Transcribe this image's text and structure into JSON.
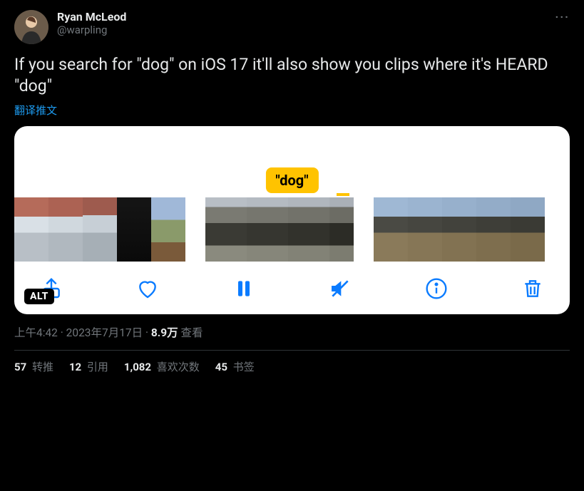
{
  "user": {
    "display_name": "Ryan McLeod",
    "handle": "@warpling"
  },
  "tweet": {
    "text": "If you search for \"dog\" on iOS 17 it'll also show you clips where it's HEARD \"dog\"",
    "translate_label": "翻译推文"
  },
  "media": {
    "search_label": "\"dog\"",
    "alt_badge": "ALT"
  },
  "meta": {
    "time": "上午4:42",
    "date": "2023年7月17日",
    "separator": " · ",
    "views_count": "8.9万",
    "views_label": " 查看"
  },
  "stats": {
    "retweets": {
      "num": "57",
      "label": " 转推"
    },
    "quotes": {
      "num": "12",
      "label": " 引用"
    },
    "likes": {
      "num": "1,082",
      "label": " 喜欢次数"
    },
    "bookmarks": {
      "num": "45",
      "label": " 书签"
    }
  }
}
